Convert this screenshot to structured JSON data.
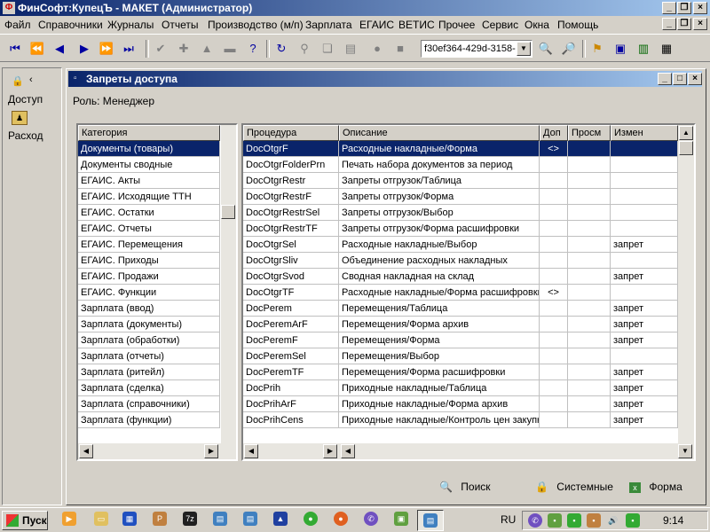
{
  "window": {
    "title": "ФинСофт:КупецЪ - МАКЕТ  (Администратор)"
  },
  "menu": [
    "Файл",
    "Справочники",
    "Журналы",
    "Отчеты",
    "Производство (м/п)",
    "Зарплата",
    "ЕГАИС",
    "ВЕТИС",
    "Прочее",
    "Сервис",
    "Окна",
    "Помощь"
  ],
  "toolbar": {
    "combo_value": "f30ef364-429d-3158-"
  },
  "left_panel": {
    "items": [
      {
        "label": "Доступ"
      },
      {
        "label": "Расход"
      }
    ]
  },
  "child": {
    "title": "Запреты доступа",
    "role_label": "Роль: Менеджер",
    "categories_header": "Категория",
    "categories": [
      "Документы (товары)",
      "Документы сводные",
      "ЕГАИС. Акты",
      "ЕГАИС. Исходящие ТТН",
      "ЕГАИС. Остатки",
      "ЕГАИС. Отчеты",
      "ЕГАИС. Перемещения",
      "ЕГАИС. Приходы",
      "ЕГАИС. Продажи",
      "ЕГАИС. Функции",
      "Зарплата (ввод)",
      "Зарплата (документы)",
      "Зарплата (обработки)",
      "Зарплата (отчеты)",
      "Зарплата (ритейл)",
      "Зарплата (сделка)",
      "Зарплата (справочники)",
      "Зарплата (функции)"
    ],
    "columns": [
      "Процедура",
      "Описание",
      "Доп",
      "Просм",
      "Измен"
    ],
    "rows": [
      [
        "DocOtgrF",
        "Расходные накладные/Форма",
        "<>",
        "",
        ""
      ],
      [
        "DocOtgrFolderPrn",
        "Печать набора документов за период",
        "",
        "",
        ""
      ],
      [
        "DocOtgrRestr",
        "Запреты отгрузок/Таблица",
        "",
        "",
        ""
      ],
      [
        "DocOtgrRestrF",
        "Запреты отгрузок/Форма",
        "",
        "",
        ""
      ],
      [
        "DocOtgrRestrSel",
        "Запреты отгрузок/Выбор",
        "",
        "",
        ""
      ],
      [
        "DocOtgrRestrTF",
        "Запреты отгрузок/Форма расшифровки",
        "",
        "",
        ""
      ],
      [
        "DocOtgrSel",
        "Расходные накладные/Выбор",
        "",
        "",
        "запрет"
      ],
      [
        "DocOtgrSliv",
        "Объединение расходных накладных",
        "",
        "",
        ""
      ],
      [
        "DocOtgrSvod",
        "Сводная накладная на склад",
        "",
        "",
        "запрет"
      ],
      [
        "DocOtgrTF",
        "Расходные накладные/Форма расшифровки",
        "<>",
        "",
        ""
      ],
      [
        "DocPerem",
        "Перемещения/Таблица",
        "",
        "",
        "запрет"
      ],
      [
        "DocPeremArF",
        "Перемещения/Форма архив",
        "",
        "",
        "запрет"
      ],
      [
        "DocPeremF",
        "Перемещения/Форма",
        "",
        "",
        "запрет"
      ],
      [
        "DocPeremSel",
        "Перемещения/Выбор",
        "",
        "",
        ""
      ],
      [
        "DocPeremTF",
        "Перемещения/Форма расшифровки",
        "",
        "",
        "запрет"
      ],
      [
        "DocPrih",
        "Приходные накладные/Таблица",
        "",
        "",
        "запрет"
      ],
      [
        "DocPrihArF",
        "Приходные накладные/Форма архив",
        "",
        "",
        "запрет"
      ],
      [
        "DocPrihCens",
        "Приходные накладные/Контроль цен закупки",
        "",
        "",
        "запрет"
      ]
    ],
    "buttons": {
      "search": "Поиск",
      "system": "Системные",
      "form": "Форма"
    }
  },
  "taskbar": {
    "start": "Пуск",
    "lang": "RU",
    "clock": "9:14"
  }
}
